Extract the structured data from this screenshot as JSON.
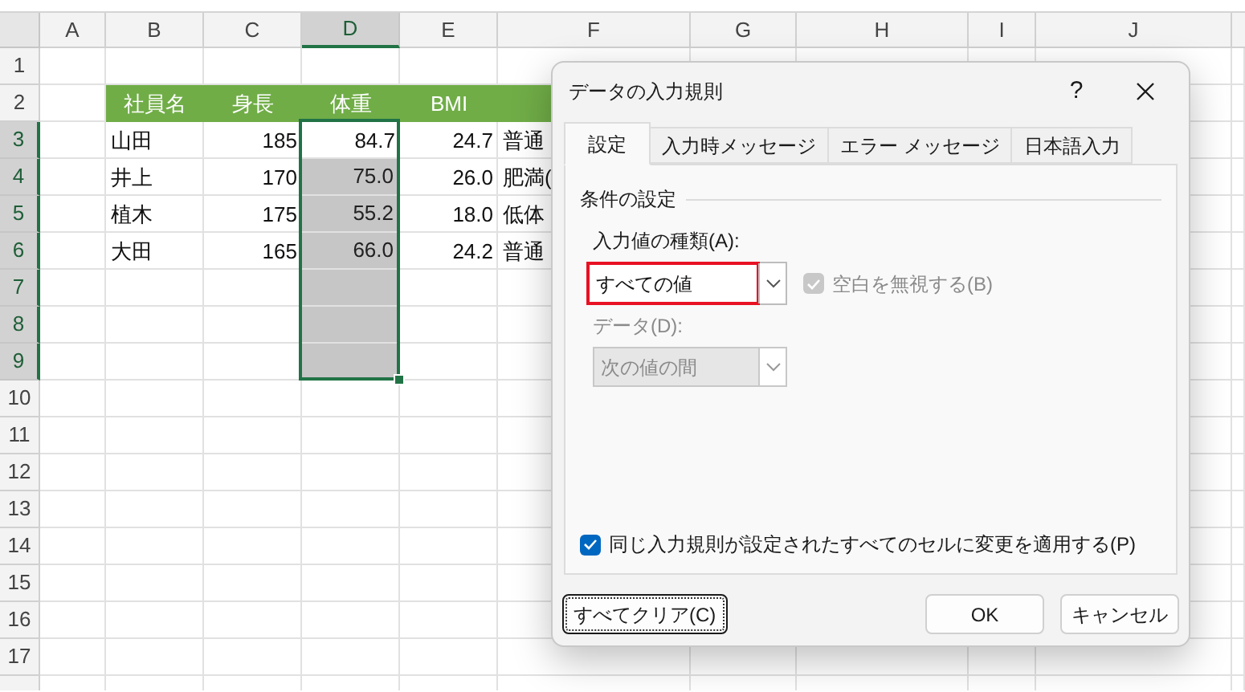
{
  "sheet": {
    "columns": [
      {
        "label": "A",
        "selected": false
      },
      {
        "label": "B",
        "selected": false
      },
      {
        "label": "C",
        "selected": false
      },
      {
        "label": "D",
        "selected": true
      },
      {
        "label": "E",
        "selected": false
      },
      {
        "label": "F",
        "selected": false
      },
      {
        "label": "G",
        "selected": false
      },
      {
        "label": "H",
        "selected": false
      },
      {
        "label": "I",
        "selected": false
      },
      {
        "label": "J",
        "selected": false
      }
    ],
    "rows": [
      {
        "label": "1",
        "selected": false
      },
      {
        "label": "2",
        "selected": false
      },
      {
        "label": "3",
        "selected": true
      },
      {
        "label": "4",
        "selected": true
      },
      {
        "label": "5",
        "selected": true
      },
      {
        "label": "6",
        "selected": true
      },
      {
        "label": "7",
        "selected": true
      },
      {
        "label": "8",
        "selected": true
      },
      {
        "label": "9",
        "selected": true
      },
      {
        "label": "10",
        "selected": false
      },
      {
        "label": "11",
        "selected": false
      },
      {
        "label": "12",
        "selected": false
      },
      {
        "label": "13",
        "selected": false
      },
      {
        "label": "14",
        "selected": false
      },
      {
        "label": "15",
        "selected": false
      },
      {
        "label": "16",
        "selected": false
      },
      {
        "label": "17",
        "selected": false
      }
    ],
    "table": {
      "header": [
        "社員名",
        "身長",
        "体重",
        "BMI"
      ],
      "rows": [
        [
          "山田",
          "185",
          "84.7",
          "24.7",
          "普通"
        ],
        [
          "井上",
          "170",
          "75.0",
          "26.0",
          "肥満("
        ],
        [
          "植木",
          "175",
          "55.2",
          "18.0",
          "低体"
        ],
        [
          "大田",
          "165",
          "66.0",
          "24.2",
          "普通"
        ]
      ]
    }
  },
  "dialog": {
    "title": "データの入力規則",
    "help": "?",
    "tabs": [
      {
        "label": "設定",
        "selected": true
      },
      {
        "label": "入力時メッセージ",
        "selected": false
      },
      {
        "label": "エラー メッセージ",
        "selected": false
      },
      {
        "label": "日本語入力",
        "selected": false
      }
    ],
    "group_title": "条件の設定",
    "allow": {
      "label": "入力値の種類(A):",
      "value": "すべての値",
      "highlighted": true
    },
    "ignore_blank": {
      "label": "空白を無視する(B)",
      "checked": true,
      "disabled": true
    },
    "data": {
      "label": "データ(D):",
      "value": "次の値の間",
      "disabled": true
    },
    "apply_all": {
      "label": "同じ入力規則が設定されたすべてのセルに変更を適用する(P)",
      "checked": true
    },
    "buttons": [
      {
        "label": "すべてクリア(C)",
        "kind": "focused"
      },
      {
        "label": "OK",
        "kind": "normal"
      },
      {
        "label": "キャンセル",
        "kind": "normal"
      }
    ]
  }
}
